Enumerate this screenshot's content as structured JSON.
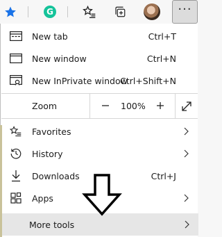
{
  "toolbar": {
    "icons": [
      "star-icon",
      "grammarly-icon",
      "favorites-icon",
      "collections-icon",
      "avatar",
      "more-icon"
    ],
    "grammarly_letter": "G",
    "accent": "#1a73e8"
  },
  "menu": {
    "new_tab": {
      "label": "New tab",
      "shortcut": "Ctrl+T"
    },
    "new_window": {
      "label": "New window",
      "shortcut": "Ctrl+N"
    },
    "new_inprivate": {
      "label": "New InPrivate window",
      "shortcut": "Ctrl+Shift+N"
    },
    "zoom": {
      "label": "Zoom",
      "value": "100%"
    },
    "favorites": {
      "label": "Favorites"
    },
    "history": {
      "label": "History"
    },
    "downloads": {
      "label": "Downloads",
      "shortcut": "Ctrl+J"
    },
    "apps": {
      "label": "Apps"
    },
    "more_tools": {
      "label": "More tools"
    }
  }
}
